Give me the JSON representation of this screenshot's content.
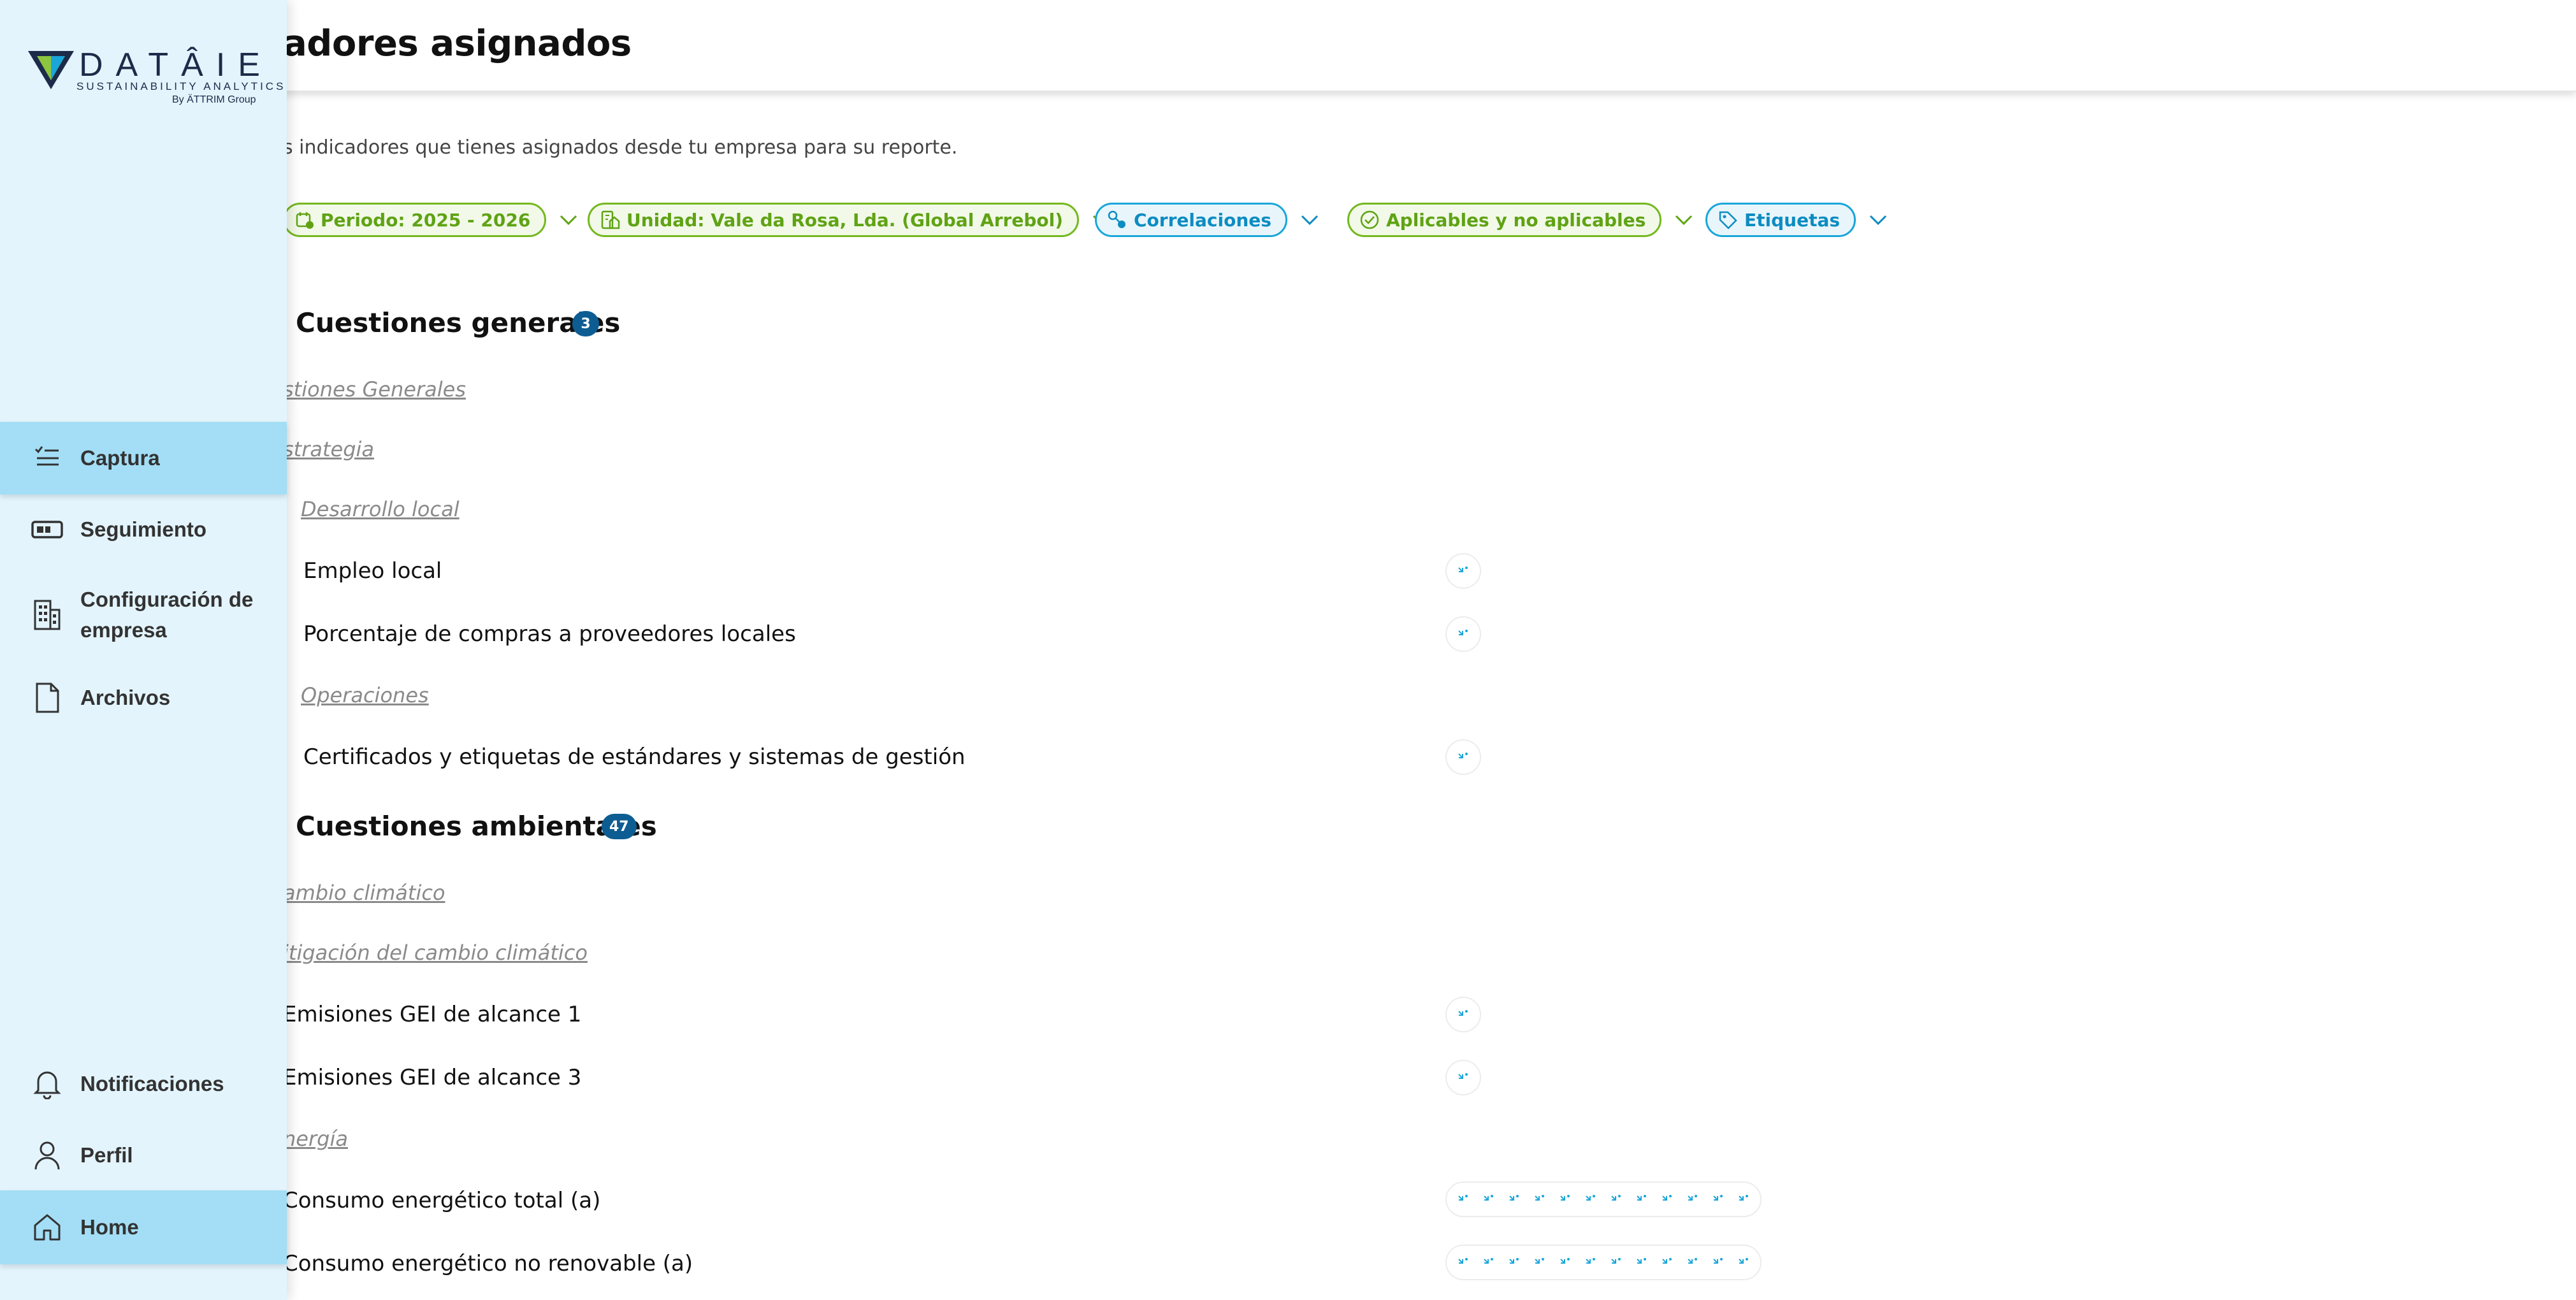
{
  "header": {
    "title": "adores asignados",
    "subtitle": "s indicadores que tienes asignados desde tu empresa para su reporte."
  },
  "filters": [
    {
      "label": "Periodo: 2025 - 2026",
      "color": "green",
      "icon": "calendar-icon"
    },
    {
      "label": "Unidad: Vale da Rosa, Lda. (Global Arrebol)",
      "color": "green",
      "icon": "building-icon"
    },
    {
      "label": "Correlaciones",
      "color": "blue",
      "icon": "correlation-icon"
    },
    {
      "label": "Aplicables y no aplicables",
      "color": "green",
      "icon": "check-circle-icon"
    },
    {
      "label": "Etiquetas",
      "color": "blue",
      "icon": "tag-icon"
    }
  ],
  "sections": {
    "general": {
      "title": "Cuestiones generales",
      "count": "3",
      "cat1": "stiones Generales",
      "cat2": "strategia",
      "sub1": "Desarrollo local",
      "ind1": "Empleo local",
      "ind2": "Porcentaje de compras a proveedores locales",
      "sub2": "Operaciones",
      "ind3": "Certificados y etiquetas de estándares y sistemas de gestión"
    },
    "environmental": {
      "title": "Cuestiones ambientales",
      "count": "47",
      "cat1": "ambio climático",
      "cat2": "itigación del cambio climático",
      "ind1": "Emisiones GEI de alcance 1",
      "ind2": "Emisiones GEI de alcance 3",
      "cat3": "nergía",
      "ind3": "Consumo energético total (a)",
      "ind4": "Consumo energético no renovable (a)"
    }
  },
  "sidebar": {
    "logo": {
      "word": "DATÂIE",
      "tagline": "SUSTAINABILITY ANALYTICS",
      "by": "By ÄTTRIM Group"
    },
    "items": [
      {
        "label": "Captura",
        "icon": "checklist-icon",
        "active": true
      },
      {
        "label": "Seguimiento",
        "icon": "progress-icon",
        "active": false
      },
      {
        "label": "Configuración de empresa",
        "icon": "building-icon",
        "active": false
      },
      {
        "label": "Archivos",
        "icon": "file-icon",
        "active": false
      }
    ],
    "bottom_items": [
      {
        "label": "Notificaciones",
        "icon": "bell-icon",
        "active": false
      },
      {
        "label": "Perfil",
        "icon": "user-icon",
        "active": false
      },
      {
        "label": "Home",
        "icon": "home-icon",
        "active": true
      }
    ]
  },
  "colors": {
    "green": "#74b81f",
    "blue": "#1aa6d9",
    "badge": "#0d5d93",
    "sidebar_bg": "#e3f4fc",
    "sidebar_active": "#a3def6"
  }
}
